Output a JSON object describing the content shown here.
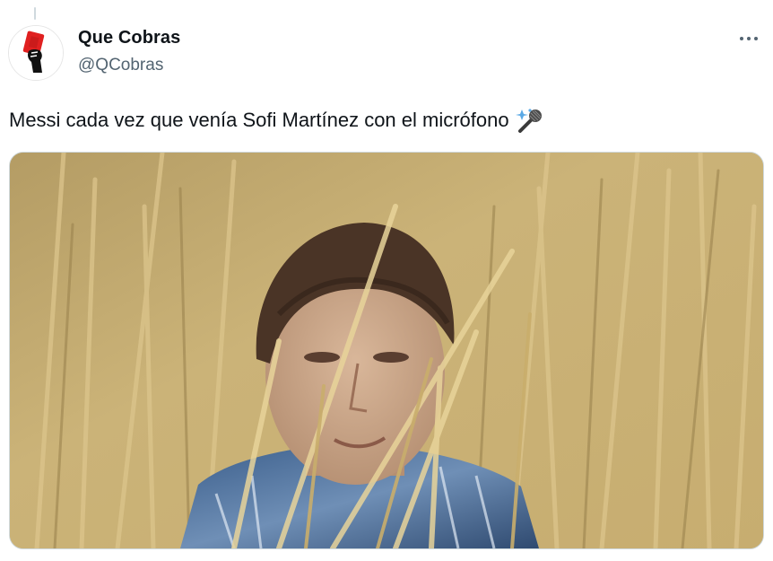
{
  "tweet": {
    "author": {
      "display_name": "Que Cobras",
      "handle": "@QCobras",
      "avatar_icon": "hand-holding-red-card-icon"
    },
    "text": "Messi cada vez que venía Sofi Martínez con el micrófono",
    "text_emoji_icon": "microphone-emoji-icon",
    "media": {
      "type": "image",
      "alt_subject": "young man peeking through tall golden grass"
    },
    "more_icon": "more-options-icon"
  },
  "colors": {
    "text": "#0f1419",
    "secondary_text": "#536471",
    "border": "#cfd9de",
    "avatar_card": "#e02020"
  }
}
